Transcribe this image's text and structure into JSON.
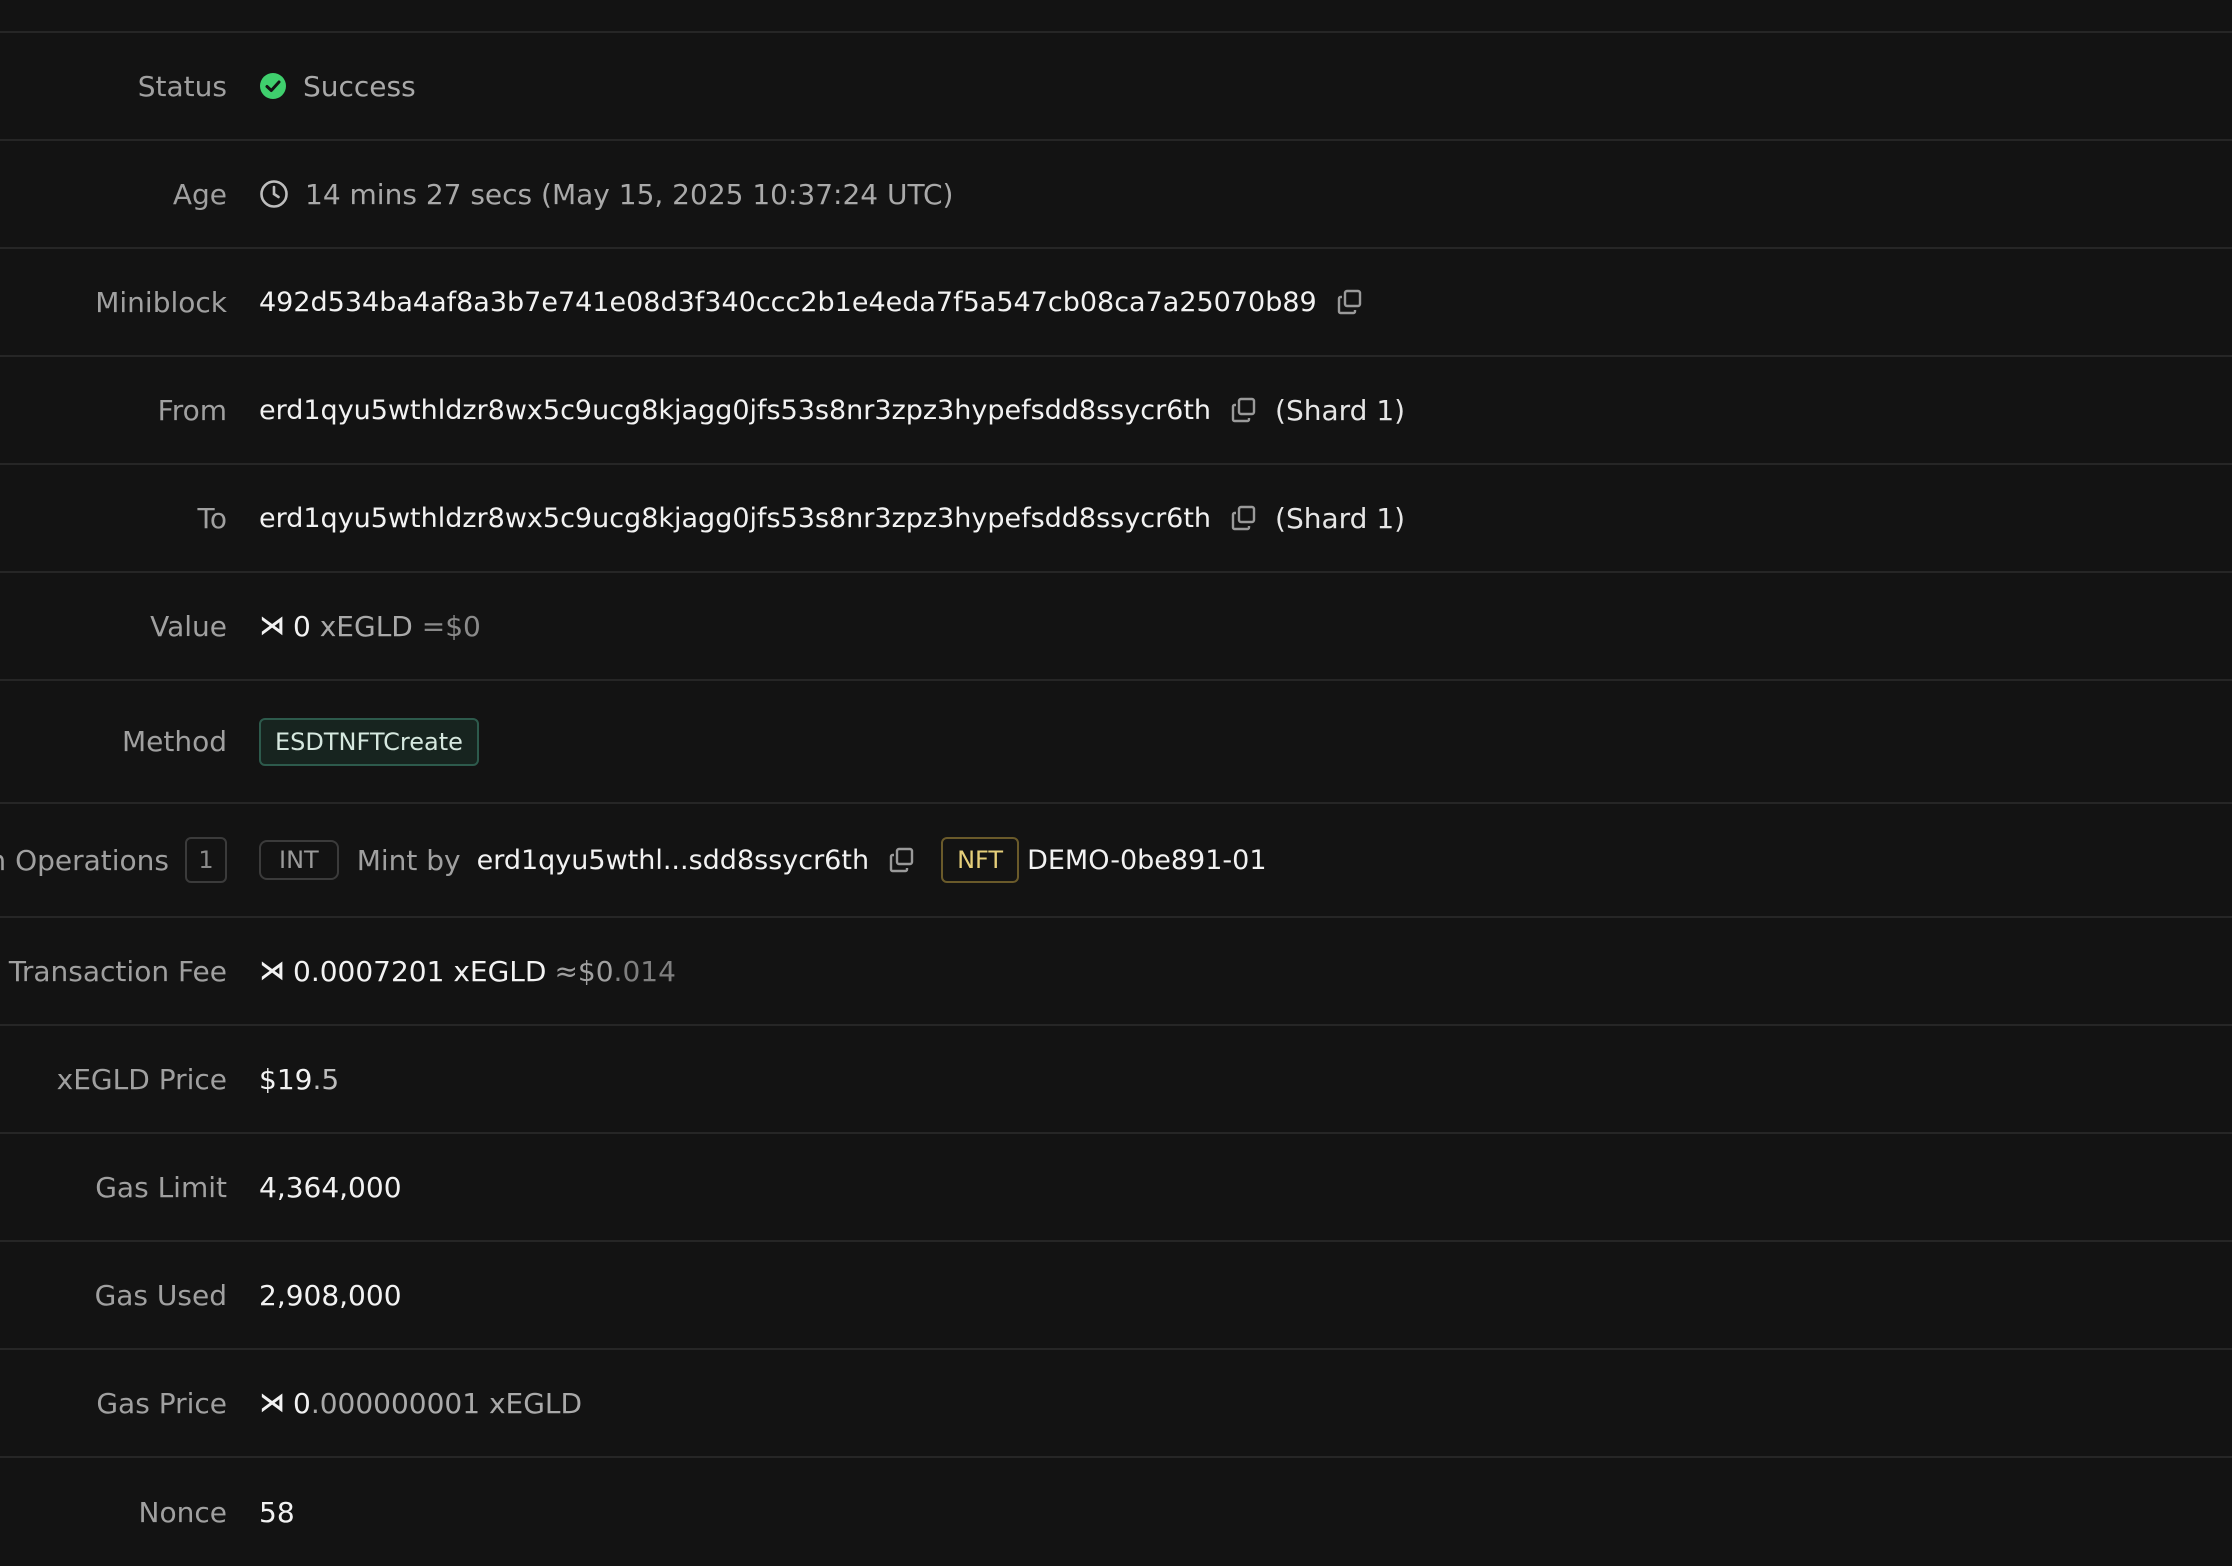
{
  "rows": {
    "status": {
      "label": "Status",
      "value": "Success",
      "icon": "check-circle-icon",
      "color": "#3fcf6d"
    },
    "age": {
      "label": "Age",
      "value": "14 mins 27 secs (May 15, 2025 10:37:24 UTC)",
      "icon": "clock-icon"
    },
    "miniblock": {
      "label": "Miniblock",
      "value": "492d534ba4af8a3b7e741e08d3f340ccc2b1e4eda7f5a547cb08ca7a25070b89",
      "icon": "copy-icon"
    },
    "from": {
      "label": "From",
      "value": "erd1qyu5wthldzr8wx5c9ucg8kjagg0jfs53s8nr3zpz3hypefsdd8ssycr6th",
      "shard": "(Shard 1)",
      "icon": "copy-icon"
    },
    "to": {
      "label": "To",
      "value": "erd1qyu5wthldzr8wx5c9ucg8kjagg0jfs53s8nr3zpz3hypefsdd8ssycr6th",
      "shard": "(Shard 1)",
      "icon": "copy-icon"
    },
    "value": {
      "label": "Value",
      "symbol": "⋊",
      "amount": "0",
      "unit": "xEGLD",
      "usd": "=$0"
    },
    "method": {
      "label": "Method",
      "value": "ESDTNFTCreate"
    },
    "operations": {
      "label": "n Operations",
      "count": "1",
      "type_badge": "INT",
      "action": "Mint by",
      "address": "erd1qyu5wthl...sdd8ssycr6th",
      "token_badge": "NFT",
      "token": "DEMO-0be891-01"
    },
    "fee": {
      "label": "Transaction Fee",
      "symbol": "⋊",
      "amount": "0.0007201",
      "unit": "xEGLD",
      "usd_prefix": "≈$0",
      "usd_dec": ".014"
    },
    "price": {
      "label": "xEGLD Price",
      "int": "$19",
      "dec": ".5"
    },
    "gas_limit": {
      "label": "Gas Limit",
      "value": "4,364,000"
    },
    "gas_used": {
      "label": "Gas Used",
      "value": "2,908,000"
    },
    "gas_price": {
      "label": "Gas Price",
      "symbol": "⋊",
      "amount_int": "0",
      "amount_dec": ".000000001",
      "unit": "xEGLD"
    },
    "nonce": {
      "label": "Nonce",
      "value": "58"
    }
  }
}
